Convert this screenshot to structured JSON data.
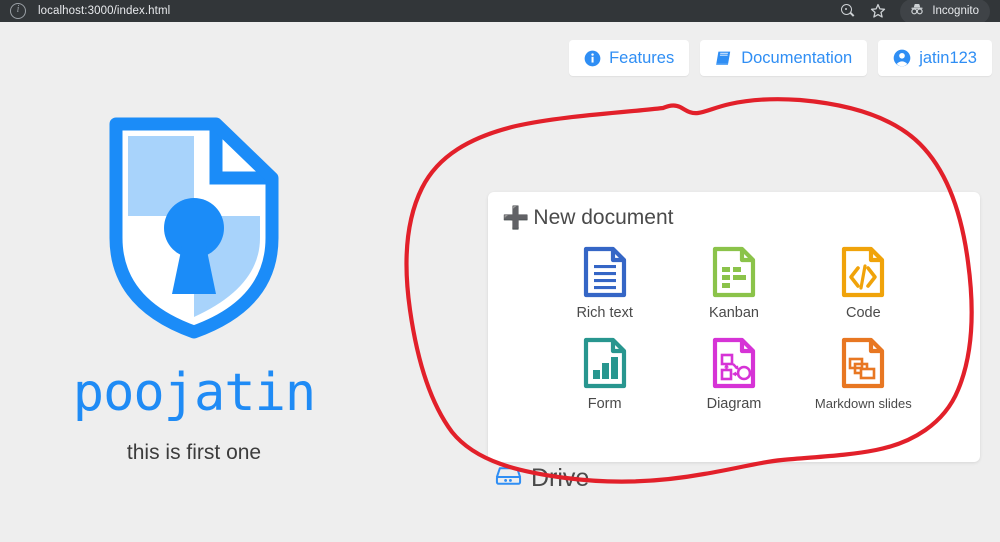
{
  "browser": {
    "url": "localhost:3000/index.html",
    "info_icon": "info-circle-icon",
    "zoom_icon": "zoom-search-icon",
    "bookmark_icon": "star-icon",
    "incognito_icon": "incognito-icon",
    "incognito_label": "Incognito"
  },
  "topnav": {
    "buttons": [
      {
        "label": "Features",
        "icon": "info-icon"
      },
      {
        "label": "Documentation",
        "icon": "book-icon"
      },
      {
        "label": "jatin123",
        "icon": "user-avatar-icon"
      }
    ]
  },
  "hero": {
    "logo_icon": "cryptpad-shield-lock-logo",
    "title": "poojatin",
    "subtitle": "this is first one"
  },
  "card": {
    "title": "New document",
    "plus_icon": "plus-icon",
    "types": [
      {
        "label": "Rich text",
        "icon": "rich-text-doc-icon",
        "color": "#3566c6"
      },
      {
        "label": "Kanban",
        "icon": "kanban-doc-icon",
        "color": "#8bc34a"
      },
      {
        "label": "Code",
        "icon": "code-doc-icon",
        "color": "#f0a30a"
      },
      {
        "label": "Form",
        "icon": "form-chart-doc-icon",
        "color": "#28968f"
      },
      {
        "label": "Diagram",
        "icon": "diagram-doc-icon",
        "color": "#d633d6"
      },
      {
        "label": "Markdown slides",
        "icon": "markdown-slides-doc-icon",
        "color": "#e87722"
      }
    ]
  },
  "drive": {
    "label": "Drive",
    "icon": "hard-drive-icon"
  },
  "annotation": {
    "type": "hand-drawn-circle",
    "color": "#e2202a",
    "stroke_width": 4
  },
  "colors": {
    "background": "#eeeeee",
    "accent_blue": "#2f8ef4",
    "chrome": "#323639",
    "annotation_red": "#e2202a"
  }
}
